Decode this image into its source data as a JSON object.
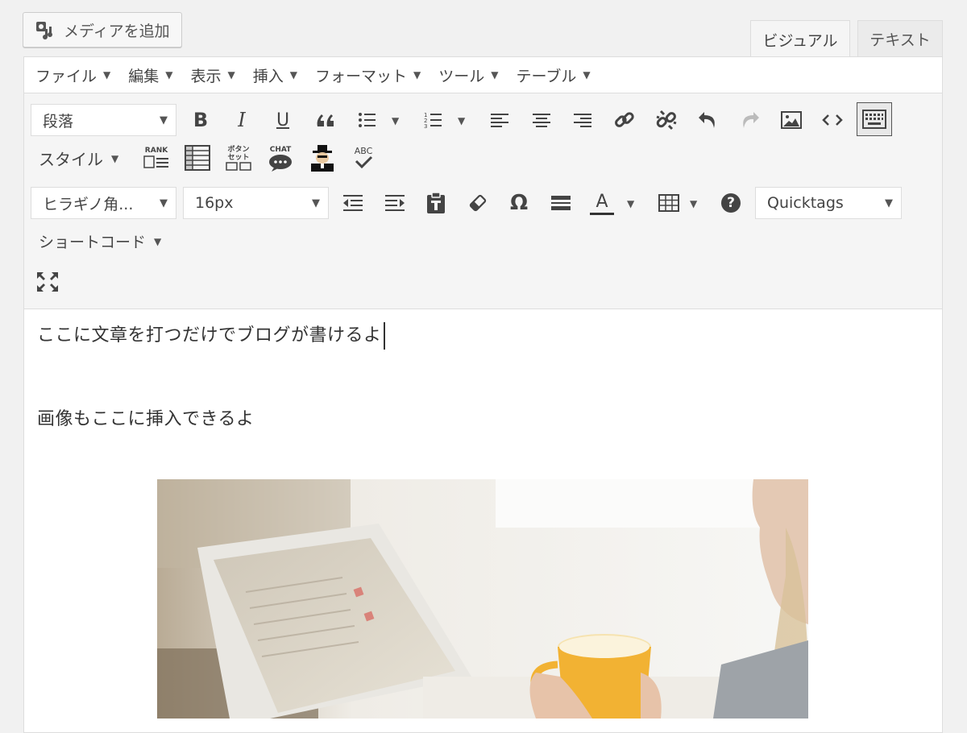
{
  "media_button": {
    "label": "メディアを追加",
    "icon": "media-add-icon"
  },
  "tabs": {
    "visual": "ビジュアル",
    "text": "テキスト"
  },
  "menubar": [
    {
      "label": "ファイル"
    },
    {
      "label": "編集"
    },
    {
      "label": "表示"
    },
    {
      "label": "挿入"
    },
    {
      "label": "フォーマット"
    },
    {
      "label": "ツール"
    },
    {
      "label": "テーブル"
    }
  ],
  "toolbar": {
    "format_select": "段落",
    "style_label": "スタイル",
    "font_family_select": "ヒラギノ角...",
    "font_size_select": "16px",
    "quicktags_select": "Quicktags",
    "shortcode_label": "ショートコード",
    "rank_label": "RANK",
    "button_set_label_1": "ボタン",
    "button_set_label_2": "セット",
    "chat_label": "CHAT",
    "abc_label": "ABC",
    "bold_label": "B",
    "italic_label": "I",
    "underline_label": "U",
    "omega_label": "Ω",
    "text_color_label": "A",
    "help_label": "?"
  },
  "content": {
    "line1": "ここに文章を打つだけでブログが書けるよ",
    "line2": "画像もここに挿入できるよ"
  },
  "colors": {
    "accent": "#444444",
    "cup": "#f2b233"
  }
}
